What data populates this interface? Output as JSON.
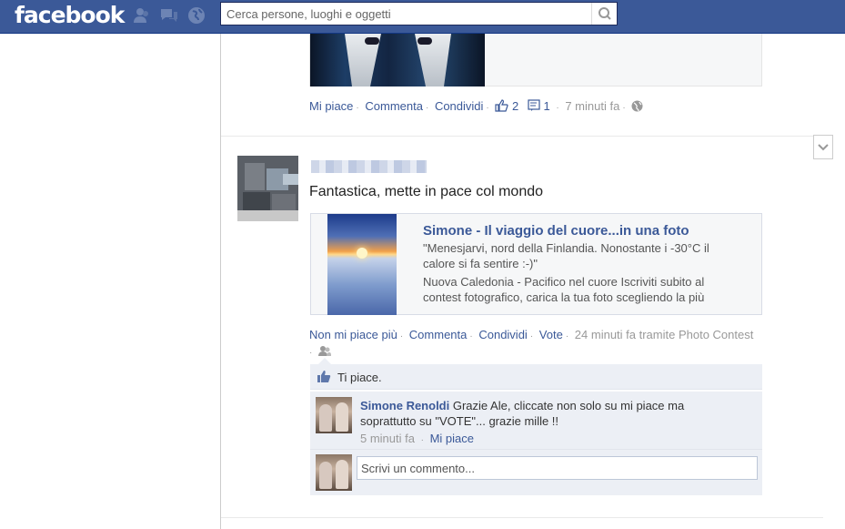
{
  "brand": {
    "logo": "facebook",
    "color": "#3b5998"
  },
  "header": {
    "search_placeholder": "Cerca persone, luoghi e oggetti",
    "icons": [
      "friend-requests-icon",
      "messages-icon",
      "notifications-globe-icon",
      "search-icon"
    ]
  },
  "post1": {
    "actions": {
      "like": "Mi piace",
      "comment": "Commenta",
      "share": "Condividi",
      "like_count": "2",
      "comment_count": "1",
      "time": "7 minuti fa"
    }
  },
  "post2": {
    "text": "Fantastica, mette in pace col mondo",
    "link": {
      "title": "Simone - Il viaggio del cuore...in una foto",
      "description": "\"Menesjarvi, nord della Finlandia. Nonostante i -30°C il calore si fa sentire :-)\"",
      "extra": "Nuova Caledonia - Pacifico nel cuore Iscriviti subito al contest fotografico, carica la tua foto scegliendo la più"
    },
    "actions": {
      "unlike": "Non mi piace più",
      "comment": "Commenta",
      "share": "Condividi",
      "vote": "Vote",
      "time_via": "24 minuti fa tramite Photo Contest"
    },
    "likes_label": "Ti piace.",
    "comment": {
      "author": "Simone Renoldi",
      "text": "Grazie Ale, cliccate non solo su mi piace ma soprattutto su \"VOTE\"... grazie mille !!",
      "time": "5 minuti fa",
      "like": "Mi piace"
    },
    "write_placeholder": "Scrivi un commento..."
  }
}
